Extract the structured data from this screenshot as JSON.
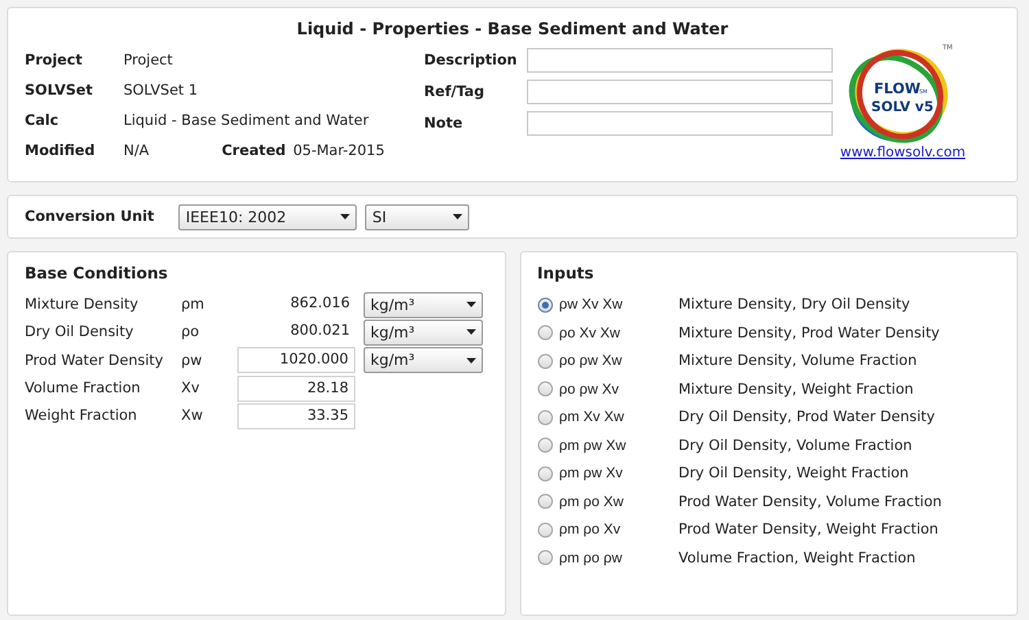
{
  "header": {
    "title": "Liquid - Properties - Base Sediment and Water",
    "info": [
      {
        "label": "Project",
        "value": "Project"
      },
      {
        "label": "SOLVSet",
        "value": "SOLVSet 1"
      },
      {
        "label": "Calc",
        "value": "Liquid - Base Sediment and Water"
      }
    ],
    "modified": {
      "label": "Modified",
      "value": "N/A"
    },
    "created": {
      "label": "Created",
      "value": "05-Mar-2015"
    },
    "fields": [
      {
        "label": "Description"
      },
      {
        "label": "Ref/Tag"
      },
      {
        "label": "Note"
      }
    ],
    "logo": {
      "line_1": "FLOW",
      "service_mark": "SM",
      "line_2": "SOLV v5",
      "trademark": "TM"
    },
    "link": "www.flowsolv.com"
  },
  "conversion": {
    "label": "Conversion Unit",
    "standard": "IEEE10: 2002",
    "system": "SI"
  },
  "base_conditions": {
    "title": "Base Conditions",
    "rows": [
      {
        "label": "Mixture Density",
        "symbol": "ρm",
        "kind": "computed",
        "value": "862.016",
        "unit": "kg/m³"
      },
      {
        "label": "Dry Oil Density",
        "symbol": "ρo",
        "kind": "computed",
        "value": "800.021",
        "unit": "kg/m³"
      },
      {
        "label": "Prod Water Density",
        "symbol": "ρw",
        "kind": "input",
        "value": "1020.000",
        "unit": "kg/m³"
      },
      {
        "label": "Volume Fraction",
        "symbol": "Xv",
        "kind": "input",
        "value": "28.18"
      },
      {
        "label": "Weight Fraction",
        "symbol": "Xw",
        "kind": "input",
        "value": "33.35"
      }
    ]
  },
  "inputs": {
    "title": "Inputs",
    "options": [
      {
        "symbols": "ρw Xv Xw",
        "description": "Mixture Density,  Dry Oil Density",
        "selected": true
      },
      {
        "symbols": "ρo Xv Xw",
        "description": "Mixture Density,  Prod Water Density",
        "selected": false
      },
      {
        "symbols": "ρo ρw Xw",
        "description": "Mixture Density,  Volume Fraction",
        "selected": false
      },
      {
        "symbols": "ρo ρw Xv",
        "description": "Mixture Density,  Weight Fraction",
        "selected": false
      },
      {
        "symbols": "ρm Xv Xw",
        "description": "Dry Oil Density,  Prod Water Density",
        "selected": false
      },
      {
        "symbols": "ρm ρw Xw",
        "description": "Dry Oil Density,  Volume Fraction",
        "selected": false
      },
      {
        "symbols": "ρm ρw Xv",
        "description": "Dry Oil Density,  Weight Fraction",
        "selected": false
      },
      {
        "symbols": "ρm ρo Xw",
        "description": "Prod Water Density,  Volume Fraction",
        "selected": false
      },
      {
        "symbols": "ρm ρo Xv",
        "description": "Prod Water Density,  Weight Fraction",
        "selected": false
      },
      {
        "symbols": "ρm ρo ρw",
        "description": "Volume Fraction,  Weight Fraction",
        "selected": false
      }
    ]
  }
}
